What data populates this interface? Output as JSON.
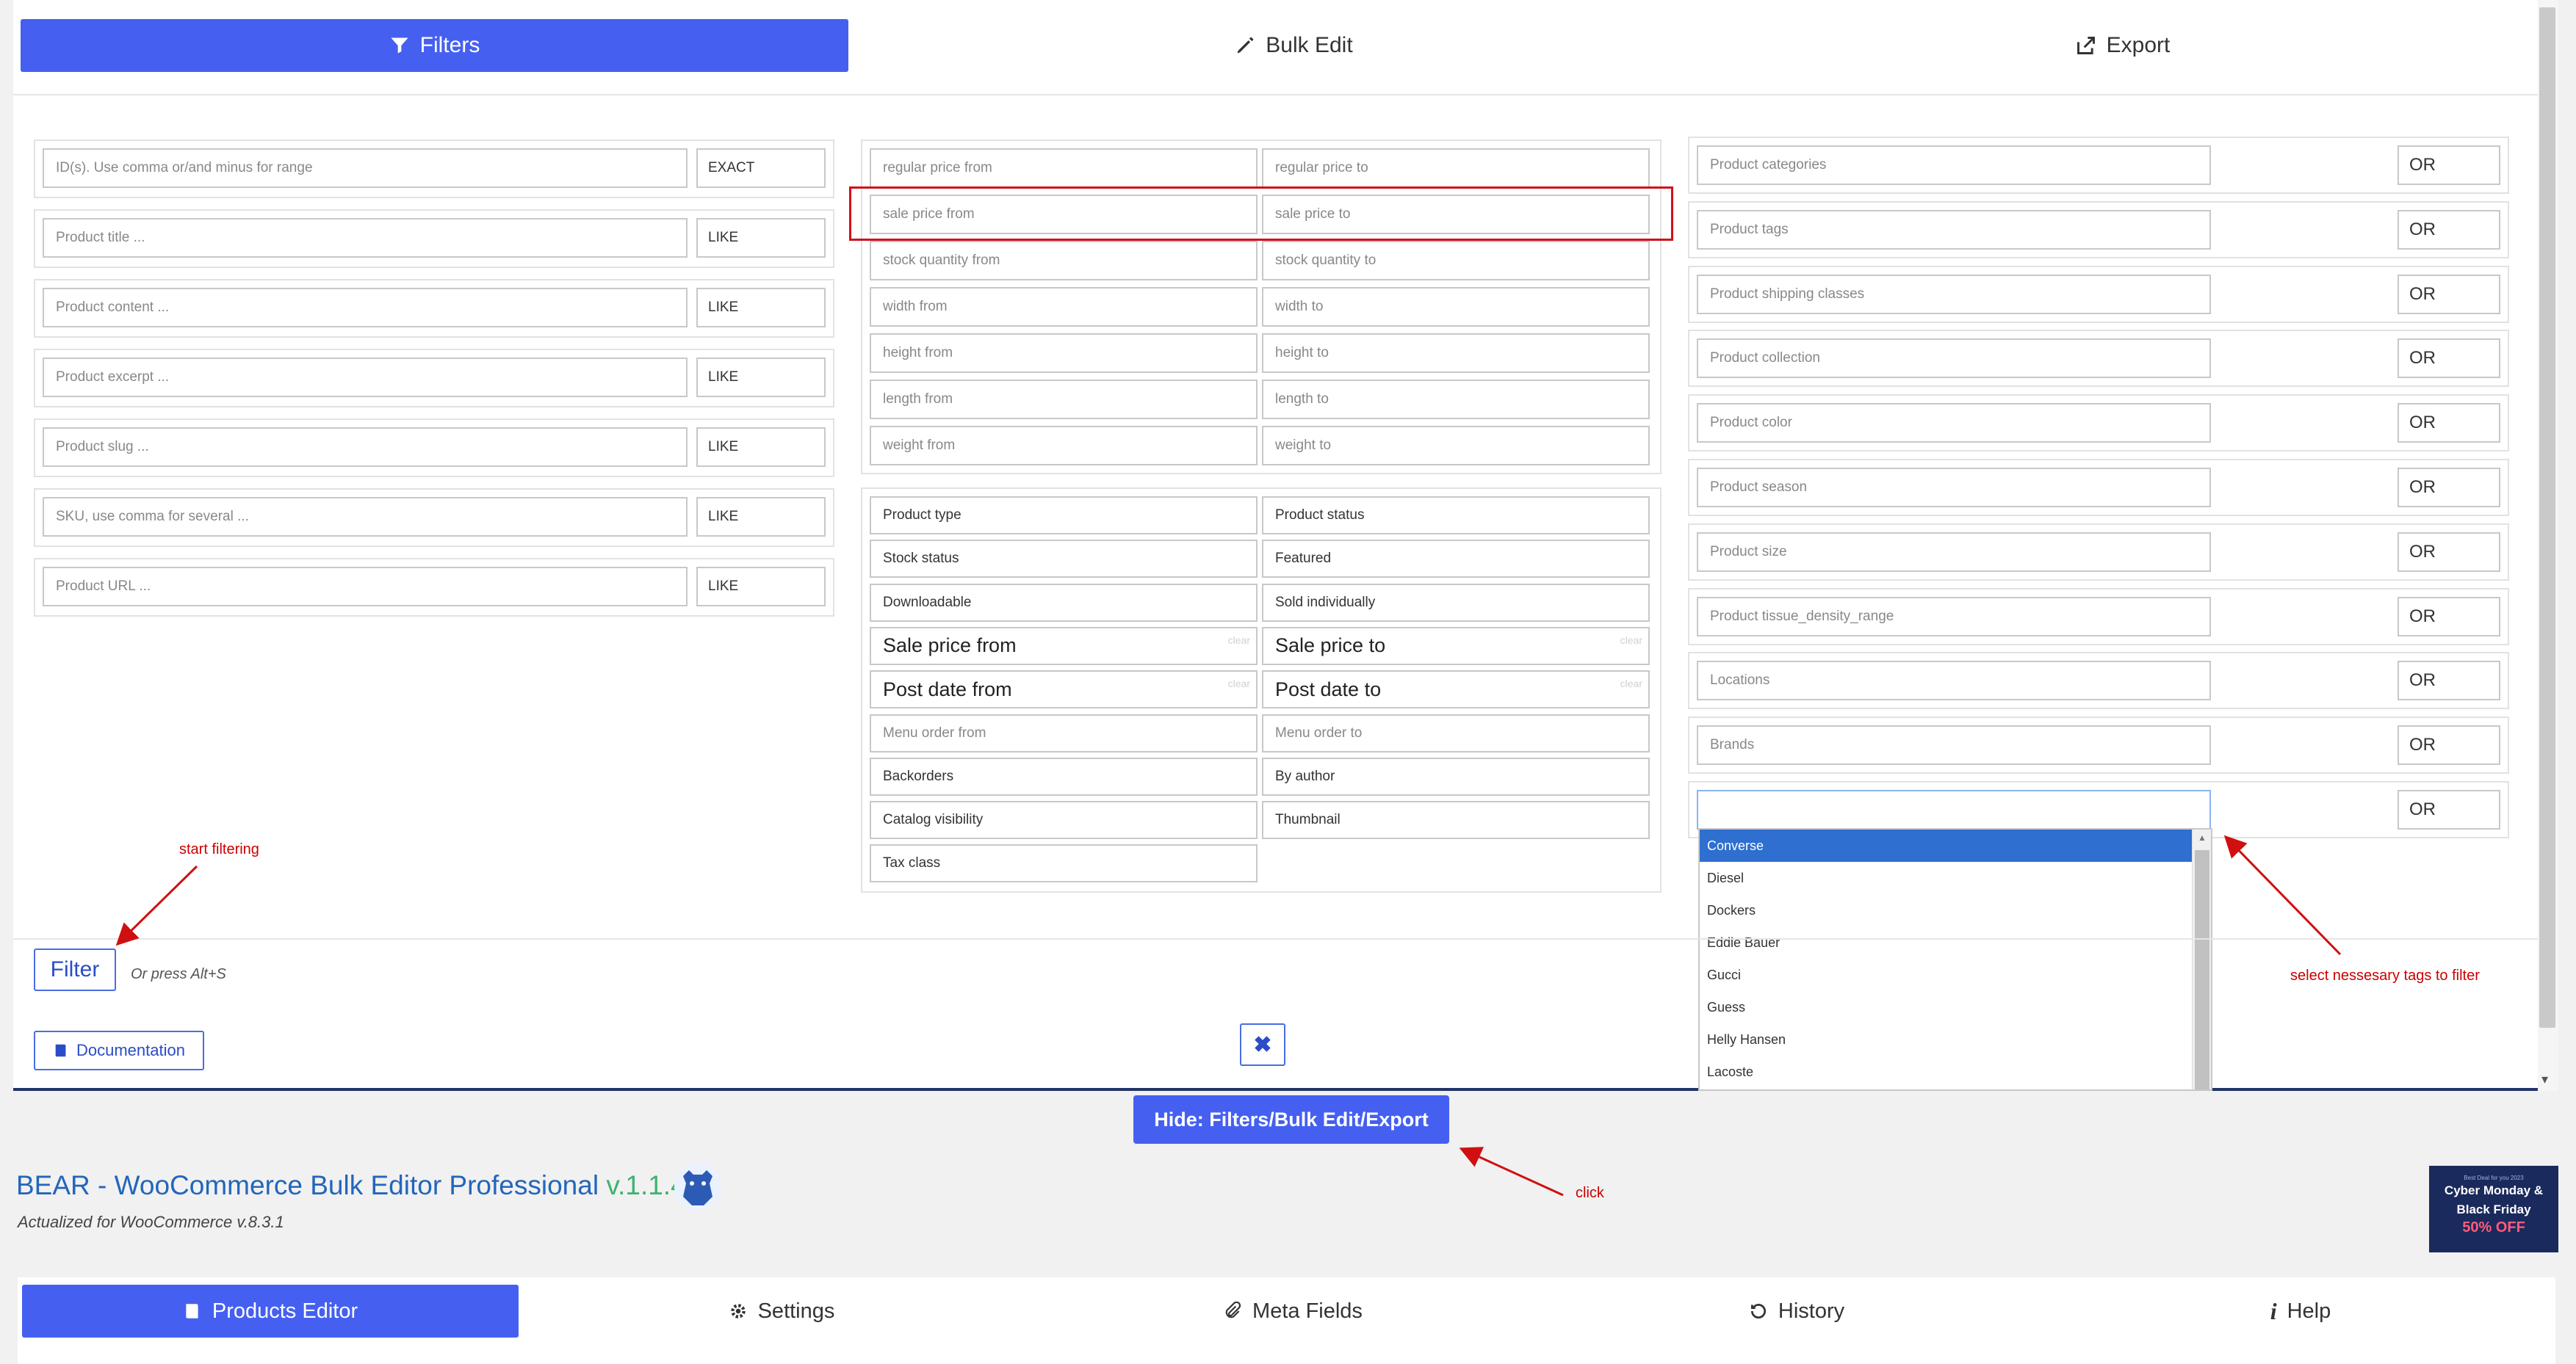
{
  "tabs": [
    {
      "label": "Filters",
      "icon": "filter-icon",
      "active": true
    },
    {
      "label": "Bulk Edit",
      "icon": "pencil-icon",
      "active": false
    },
    {
      "label": "Export",
      "icon": "export-icon",
      "active": false
    }
  ],
  "col1": [
    {
      "placeholder": "ID(s). Use comma or/and minus for range",
      "mode": "EXACT"
    },
    {
      "placeholder": "Product title ...",
      "mode": "LIKE"
    },
    {
      "placeholder": "Product content ...",
      "mode": "LIKE"
    },
    {
      "placeholder": "Product excerpt ...",
      "mode": "LIKE"
    },
    {
      "placeholder": "Product slug ...",
      "mode": "LIKE"
    },
    {
      "placeholder": "SKU, use comma for several ...",
      "mode": "LIKE"
    },
    {
      "placeholder": "Product URL ...",
      "mode": "LIKE"
    }
  ],
  "col2_ranges": [
    [
      "regular price from",
      "regular price to"
    ],
    [
      "sale price from",
      "sale price to"
    ],
    [
      "stock quantity from",
      "stock quantity to"
    ],
    [
      "width from",
      "width to"
    ],
    [
      "height from",
      "height to"
    ],
    [
      "length from",
      "length to"
    ],
    [
      "weight from",
      "weight to"
    ]
  ],
  "col2_fields": [
    [
      "Product type",
      "Product status"
    ],
    [
      "Stock status",
      "Featured"
    ],
    [
      "Downloadable",
      "Sold individually"
    ],
    [
      "Sale price from",
      "Sale price to"
    ],
    [
      "Post date from",
      "Post date to"
    ],
    [
      "Menu order from",
      "Menu order to"
    ],
    [
      "Backorders",
      "By author"
    ],
    [
      "Catalog visibility",
      "Thumbnail"
    ],
    [
      "Tax class",
      ""
    ]
  ],
  "clear_label": "clear",
  "col3": [
    {
      "placeholder": "Product categories",
      "logic": "OR"
    },
    {
      "placeholder": "Product tags",
      "logic": "OR"
    },
    {
      "placeholder": "Product shipping classes",
      "logic": "OR"
    },
    {
      "placeholder": "Product collection",
      "logic": "OR"
    },
    {
      "placeholder": "Product color",
      "logic": "OR"
    },
    {
      "placeholder": "Product season",
      "logic": "OR"
    },
    {
      "placeholder": "Product size",
      "logic": "OR"
    },
    {
      "placeholder": "Product tissue_density_range",
      "logic": "OR"
    },
    {
      "placeholder": "Locations",
      "logic": "OR"
    },
    {
      "placeholder": "Brands",
      "logic": "OR"
    },
    {
      "placeholder": "",
      "logic": "OR"
    }
  ],
  "dropdown_options": [
    "Converse",
    "Diesel",
    "Dockers",
    "Eddie Bauer",
    "Gucci",
    "Guess",
    "Helly Hansen",
    "Lacoste"
  ],
  "dropdown_highlighted": "Converse",
  "annotations": {
    "start_filtering": "start filtering",
    "select_tags": "select nessesary tags to filter",
    "click": "click"
  },
  "filter_button": "Filter",
  "shortcut_hint": "Or press Alt+S",
  "documentation_button": "Documentation",
  "hide_button": "Hide: Filters/Bulk Edit/Export",
  "app": {
    "title": "BEAR - WooCommerce Bulk Editor Professional",
    "version": "v.1.1.4",
    "subtitle": "Actualized for WooCommerce v.8.3.1"
  },
  "promo": {
    "small": "Best Deal for you 2023",
    "line1": "Cyber Monday &",
    "line2": "Black Friday",
    "line3": "50% OFF"
  },
  "bottom_tabs": [
    {
      "label": "Products Editor",
      "icon": "book-icon",
      "active": true
    },
    {
      "label": "Settings",
      "icon": "gear-icon",
      "active": false
    },
    {
      "label": "Meta Fields",
      "icon": "paperclip-icon",
      "active": false
    },
    {
      "label": "History",
      "icon": "history-icon",
      "active": false
    },
    {
      "label": "Help",
      "icon": "info-icon",
      "active": false
    }
  ],
  "colors": {
    "accent": "#4560f0",
    "annotation": "#cc0000",
    "title": "#2266bb",
    "version": "#3cb371"
  }
}
